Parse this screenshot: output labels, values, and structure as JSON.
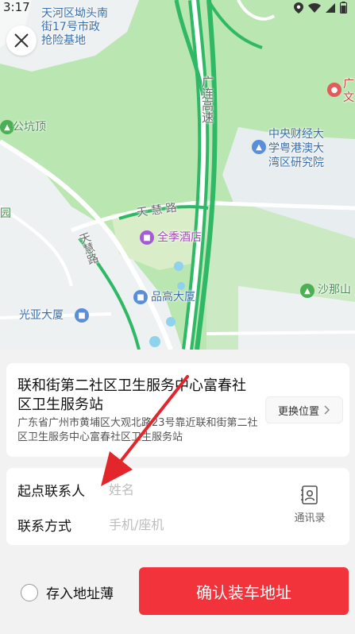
{
  "status_bar": {
    "time": "3:17"
  },
  "map": {
    "labels": {
      "rescue_base": "天河区坳头南\n街17号市政\n抢险基地",
      "guangzhou_gaosu": "广连高速",
      "gongkang_ding": "公坑顶",
      "yuan": "园",
      "university": "中央财经大\n学粤港澳大\n湾区研究院",
      "tianhui_road_h": "天 慧 路",
      "tianhui_road_v": "天慧路",
      "four_seasons": "全季酒店",
      "pingao_building": "品高大厦",
      "guangya_building": "光亚大厦",
      "shanas": "沙那山",
      "right_edge": "广\n文"
    }
  },
  "address_card": {
    "title": "联和街第二社区卫生服务中心富春社区卫生服务站",
    "detail": "广东省广州市黄埔区大观北路23号靠近联和街第二社区卫生服务中心富春社区卫生服务站",
    "change_label": "更换位置"
  },
  "contact_card": {
    "name_label": "起点联系人",
    "name_placeholder": "姓名",
    "phone_label": "联系方式",
    "phone_placeholder": "手机/座机",
    "contacts_label": "通讯录"
  },
  "footer": {
    "save_label": "存入地址薄",
    "confirm_label": "确认装车地址"
  },
  "colors": {
    "accent": "#f2333c",
    "map_green": "#b9e6b1",
    "road_green": "#2fb866"
  }
}
